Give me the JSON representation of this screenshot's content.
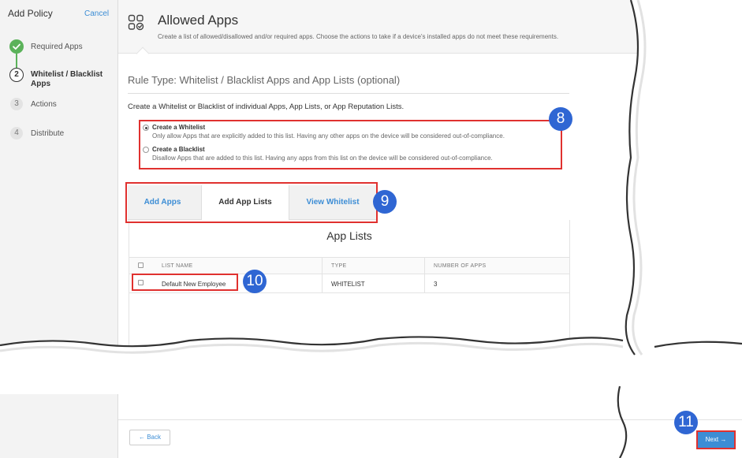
{
  "sidebar": {
    "title": "Add Policy",
    "cancel_label": "Cancel",
    "steps": [
      {
        "number": "",
        "label": "Required Apps",
        "state": "completed"
      },
      {
        "number": "2",
        "label": "Whitelist / Blacklist Apps",
        "state": "active"
      },
      {
        "number": "3",
        "label": "Actions",
        "state": "pending"
      },
      {
        "number": "4",
        "label": "Distribute",
        "state": "pending"
      }
    ]
  },
  "header": {
    "icon": "apps-check-icon",
    "title": "Allowed Apps",
    "subtitle": "Create a list of allowed/disallowed and/or required apps. Choose the actions to take if a device's installed apps do not meet these requirements."
  },
  "main": {
    "rule_type": "Rule Type: Whitelist / Blacklist Apps and App Lists (optional)",
    "intro": "Create a Whitelist or Blacklist of individual Apps, App Lists, or App Reputation Lists.",
    "options": [
      {
        "title": "Create a Whitelist",
        "description": "Only allow Apps that are explicitly added to this list. Having any other apps on the device will be considered out-of-compliance.",
        "selected": true
      },
      {
        "title": "Create a Blacklist",
        "description": "Disallow Apps that are added to this list. Having any apps from this list on the device will be considered out-of-compliance.",
        "selected": false
      }
    ],
    "tabs": [
      {
        "label": "Add Apps",
        "active": false
      },
      {
        "label": "Add App Lists",
        "active": true
      },
      {
        "label": "View Whitelist",
        "active": false
      }
    ],
    "app_lists": {
      "title": "App Lists",
      "columns": [
        "LIST NAME",
        "TYPE",
        "NUMBER OF APPS"
      ],
      "rows": [
        {
          "name": "Default New Employee",
          "type": "WHITELIST",
          "count": "3"
        }
      ]
    }
  },
  "footer": {
    "back_label": "← Back",
    "next_label": "Next →"
  },
  "callouts": [
    "8",
    "9",
    "10",
    "11"
  ],
  "colors": {
    "accent": "#3c8dd5",
    "success": "#5bb25a",
    "highlight": "#e0312f",
    "badge": "#2f66d3"
  }
}
